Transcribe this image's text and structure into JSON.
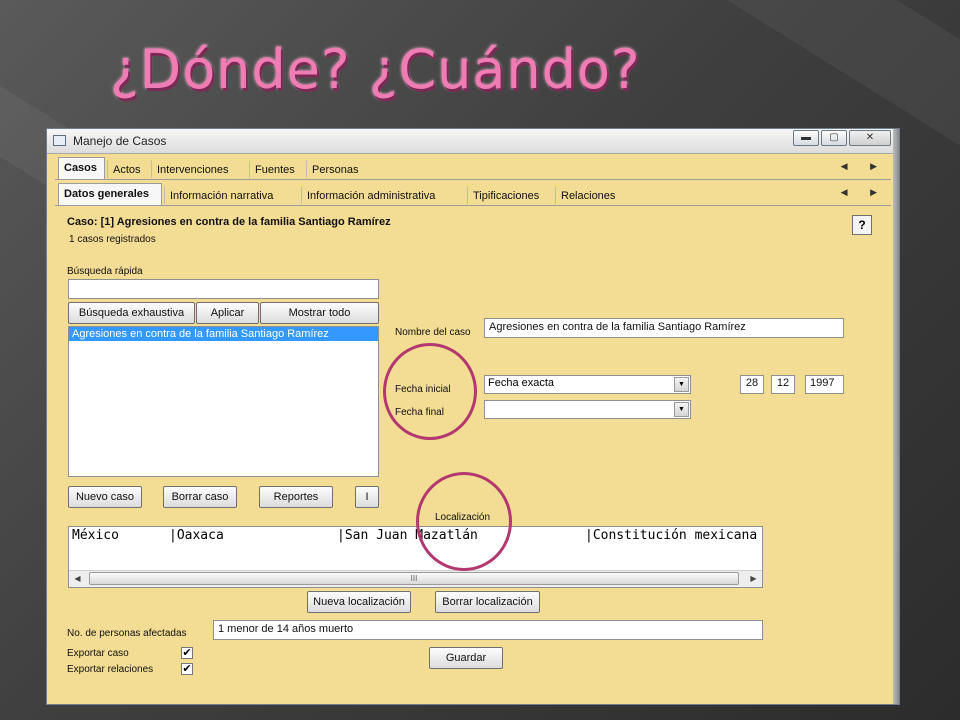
{
  "slide": {
    "title": "¿Dónde? ¿Cuándo?"
  },
  "window": {
    "title": "Manejo de Casos",
    "buttons": {
      "minimize": "▬",
      "maximize": "▢",
      "close": "✕"
    }
  },
  "tabs_main": [
    "Casos",
    "Actos",
    "Intervenciones",
    "Fuentes",
    "Personas"
  ],
  "tabs_sub": [
    "Datos generales",
    "Información narrativa",
    "Información administrativa",
    "Tipificaciones",
    "Relaciones"
  ],
  "tab_arrows": "◀ ▶",
  "case": {
    "heading": "Caso: [1] Agresiones en contra de la familia Santiago Ramírez",
    "count": "1 casos registrados",
    "help_label": "?"
  },
  "search": {
    "label": "Búsqueda rápida",
    "value": "",
    "buttons": {
      "exhaustive": "Búsqueda exhaustiva",
      "apply": "Aplicar",
      "show_all": "Mostrar todo"
    },
    "results": [
      "Agresiones en contra de la familia Santiago Ramírez"
    ]
  },
  "actions": {
    "new_case": "Nuevo caso",
    "delete_case": "Borrar caso",
    "reports": "Reportes",
    "info": "I"
  },
  "form": {
    "case_name_label": "Nombre del caso",
    "case_name_value": "Agresiones en contra de la familia Santiago Ramírez",
    "start_date_label": "Fecha inicial",
    "start_date_type": "Fecha exacta",
    "start_day": "28",
    "start_month": "12",
    "start_year": "1997",
    "end_date_label": "Fecha final",
    "end_date_type": ""
  },
  "location": {
    "label": "Localización",
    "row": [
      "México",
      "|Oaxaca",
      "|San Juan Mazatlán",
      "|Constitución mexicana"
    ],
    "scroll_grip": "III",
    "new_button": "Nueva localización",
    "delete_button": "Borrar localización"
  },
  "affected": {
    "label": "No. de personas afectadas",
    "value": "1 menor de 14 años muerto"
  },
  "export": {
    "case_label": "Exportar caso",
    "case_checked": "✔",
    "relations_label": "Exportar relaciones",
    "relations_checked": "✔"
  },
  "save_button": "Guardar",
  "colors": {
    "panel": "#f3dc93",
    "selection": "#3399ff",
    "annotation": "#b2386f",
    "title": "#f07cb4"
  }
}
